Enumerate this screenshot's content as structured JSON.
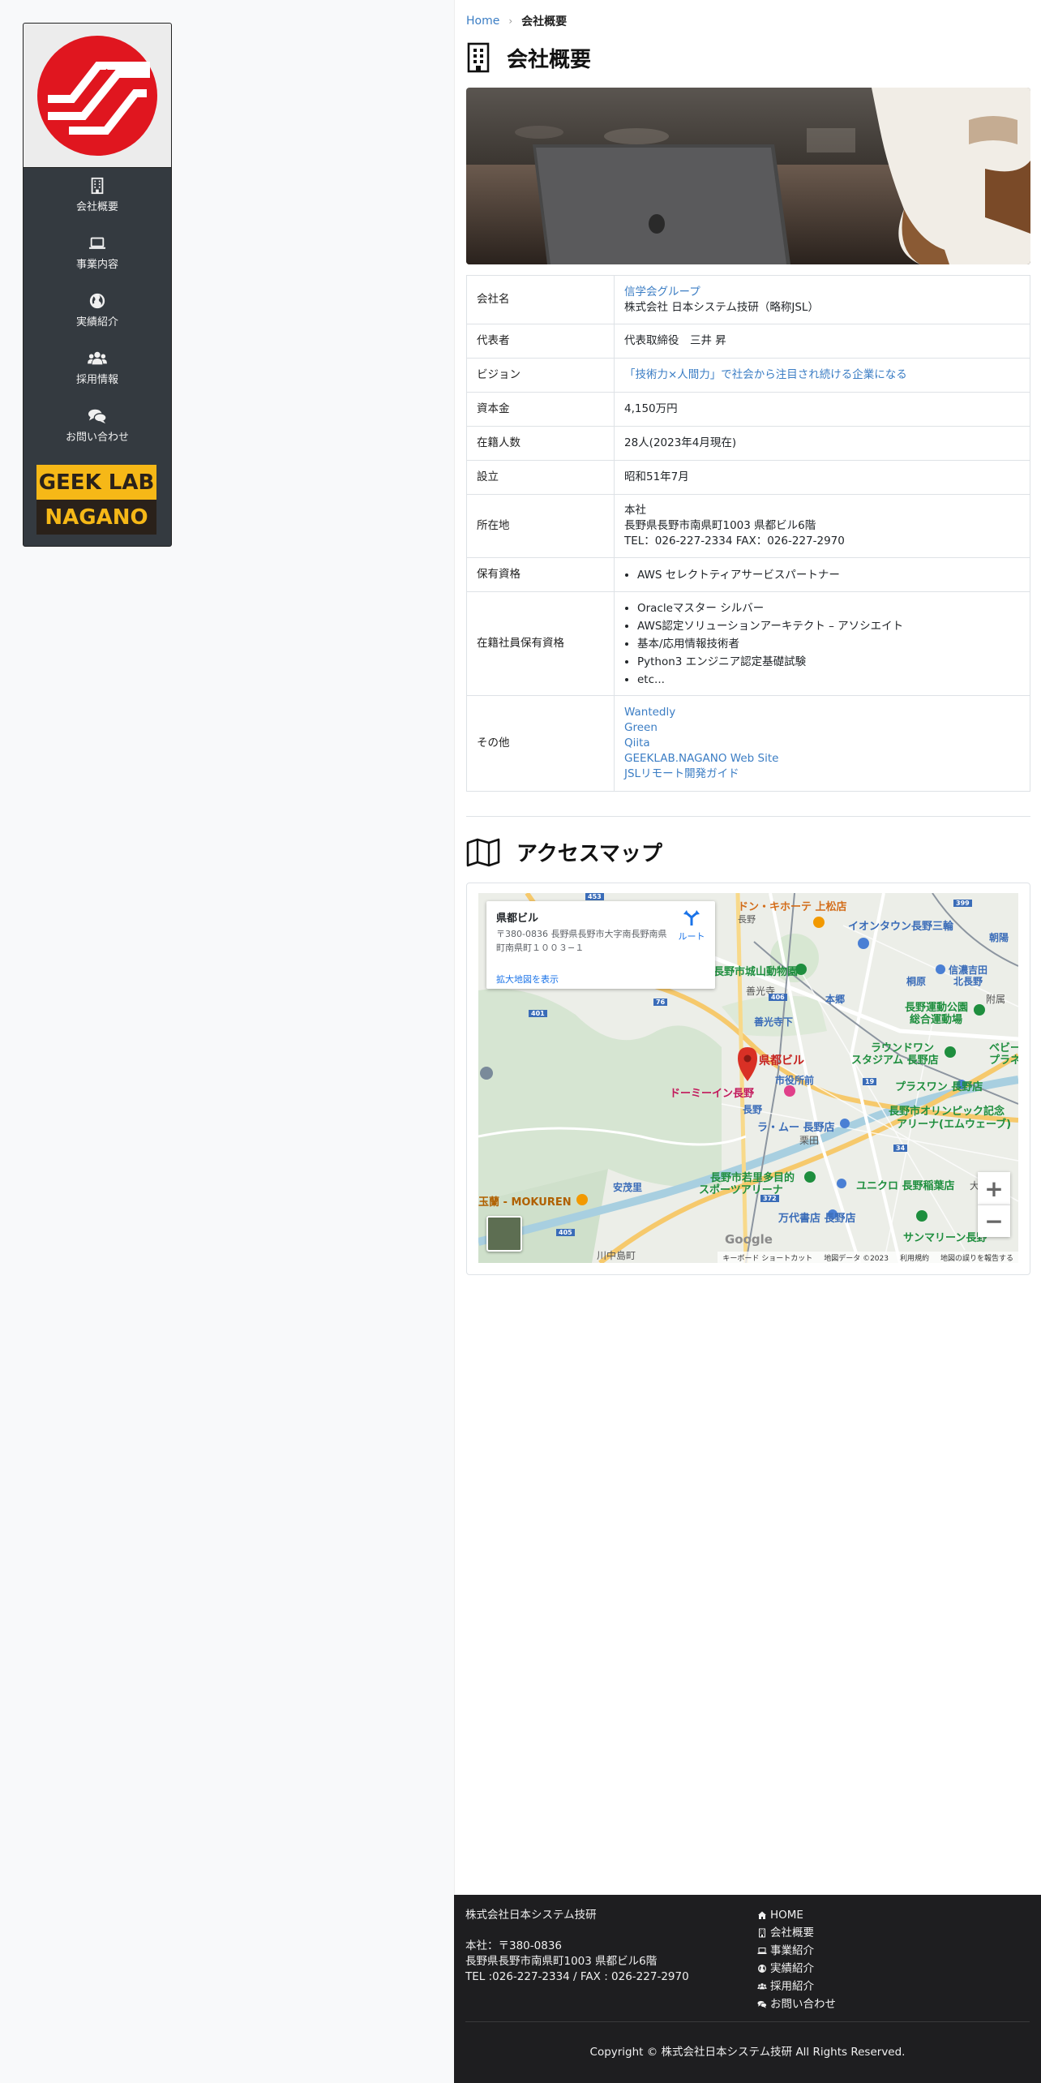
{
  "sidebar": {
    "items": [
      {
        "label": "会社概要",
        "icon": "building-icon"
      },
      {
        "label": "事業内容",
        "icon": "laptop-icon"
      },
      {
        "label": "実績紹介",
        "icon": "globe-icon"
      },
      {
        "label": "採用情報",
        "icon": "users-icon"
      },
      {
        "label": "お問い合わせ",
        "icon": "comments-icon"
      }
    ],
    "banner": {
      "top": "GEEK LAB",
      "bottom": "NAGANO"
    }
  },
  "breadcrumb": {
    "home": "Home",
    "current": "会社概要"
  },
  "page_title": "会社概要",
  "profile": {
    "company_name_label": "会社名",
    "company_group_link": "信学会グループ",
    "company_name": "株式会社 日本システム技研（略称JSL）",
    "representative_label": "代表者",
    "representative": "代表取締役　三井 昇",
    "vision_label": "ビジョン",
    "vision": "「技術力×人間力」で社会から注目され続ける企業になる",
    "capital_label": "資本金",
    "capital": "4,150万円",
    "employees_label": "在籍人数",
    "employees": "28人(2023年4月現在)",
    "founded_label": "設立",
    "founded": "昭和51年7月",
    "address_label": "所在地",
    "address_line1": "本社",
    "address_line2": "長野県長野市南県町1003 県都ビル6階",
    "address_line3": "TEL：026-227-2334 FAX：026-227-2970",
    "certs_label": "保有資格",
    "certs": [
      "AWS セレクトティアサービスパートナー"
    ],
    "staff_certs_label": "在籍社員保有資格",
    "staff_certs": [
      "Oracleマスター シルバー",
      "AWS認定ソリューションアーキテクト – アソシエイト",
      "基本/応用情報技術者",
      "Python3 エンジニア認定基礎試験",
      "etc..."
    ],
    "other_label": "その他",
    "other_links": [
      "Wantedly",
      "Green",
      "Qiita",
      "GEEKLAB.NAGANO Web Site",
      "JSLリモート開発ガイド"
    ]
  },
  "access_title": "アクセスマップ",
  "map": {
    "info_title": "県都ビル",
    "info_address": "〒380-0836 長野県長野市大字南長野南県町南県町１００３−１",
    "info_link": "拡大地図を表示",
    "route_label": "ルート",
    "pin_label": "県都ビル",
    "labels": {
      "donki": "ドン・キホーテ 上松店",
      "nagano": "長野",
      "aeon": "イオンタウン長野三輪",
      "zoo": "長野市城山動物園",
      "zenkoji": "善光寺",
      "shinano": "信濃吉田",
      "kitanagano": "北長野",
      "undo": "長野運動公園",
      "undo2": "総合運動場",
      "zenkojishita": "善光寺下",
      "stadium": "ラウンドワン",
      "stadium2": "スタジアム 長野店",
      "dormy": "ドーミーイン長野",
      "cityhall": "市役所前",
      "plaswan": "プラスワン 長野店",
      "olympic": "長野市オリンピック記念",
      "olympic2": "アリーナ(エムウェーブ)",
      "lamu": "ラ・ムー 長野店",
      "wakasato": "長野市若里多目的",
      "wakasato2": "スポーツアリーナ",
      "uniqlo": "ユニクロ 長野稲葉店",
      "mokuren": "玉蘭 - MOKUREN",
      "anmori": "安茂里",
      "tsutaya": "万代書店 長野店",
      "sunmarine": "サンマリーン長野",
      "kawanakajima": "川中島町",
      "google": "Google",
      "route453": "453",
      "route399": "399",
      "route401": "401",
      "route76": "76",
      "route406": "406",
      "route372": "372",
      "route405": "405",
      "route34": "34",
      "route19": "19",
      "asahi": "朝陽",
      "kirihara": "桐原",
      "kitanagano_station": "本郷",
      "kurita": "栗田",
      "planet": "ベビー",
      "planet2": "プラネッ",
      "fuzoku": "附属",
      "ohira": "大"
    },
    "footer": [
      "キーボード ショートカット",
      "地図データ ©2023",
      "利用規約",
      "地図の誤りを報告する"
    ]
  },
  "footer": {
    "company": "株式会社日本システム技研",
    "zip": "本社：〒380-0836",
    "address": "長野県長野市南県町1003 県都ビル6階",
    "tel": "TEL :026-227-2334 / FAX : 026-227-2970",
    "links": [
      {
        "label": "HOME",
        "icon": "home-icon"
      },
      {
        "label": "会社概要",
        "icon": "building-icon"
      },
      {
        "label": "事業紹介",
        "icon": "laptop-icon"
      },
      {
        "label": "実績紹介",
        "icon": "globe-icon"
      },
      {
        "label": "採用紹介",
        "icon": "users-icon"
      },
      {
        "label": "お問い合わせ",
        "icon": "comments-icon"
      }
    ],
    "copyright": "Copyright © 株式会社日本システム技研 All Rights Reserved."
  },
  "colors": {
    "accent_link": "#3b7dc4",
    "logo_red": "#e0161f",
    "sidebar_bg": "#343a40",
    "footer_bg": "#1e1e20",
    "banner_yellow": "#f6b817"
  }
}
